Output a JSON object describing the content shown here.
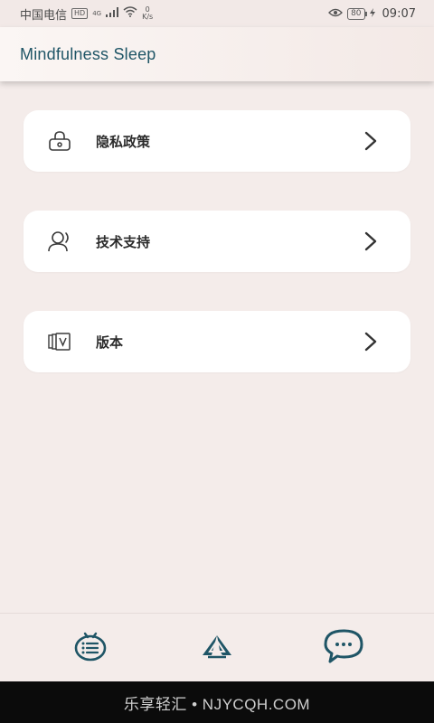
{
  "status_bar": {
    "carrier": "中国电信",
    "hd_badge": "HD",
    "network_type": "4G",
    "speed_value": "0",
    "speed_unit": "K/s",
    "battery": "80",
    "time": "09:07",
    "icons": [
      "signal-icon",
      "wifi-icon",
      "eye-icon",
      "battery-icon",
      "charging-icon"
    ]
  },
  "header": {
    "title": "Mindfulness Sleep"
  },
  "menu": {
    "items": [
      {
        "label": "隐私政策",
        "icon": "lock-icon"
      },
      {
        "label": "技术支持",
        "icon": "support-user-icon"
      },
      {
        "label": "版本",
        "icon": "version-icon"
      }
    ]
  },
  "bottom_nav": {
    "items": [
      {
        "icon": "list-icon"
      },
      {
        "icon": "triangle-logo-icon"
      },
      {
        "icon": "chat-bubble-icon"
      }
    ]
  },
  "watermark": {
    "text": "乐享轻汇 • NJYCQH.COM"
  },
  "colors": {
    "background": "#f4ecea",
    "title": "#1f5566",
    "icon_teal": "#1f5566",
    "card": "#ffffff"
  }
}
